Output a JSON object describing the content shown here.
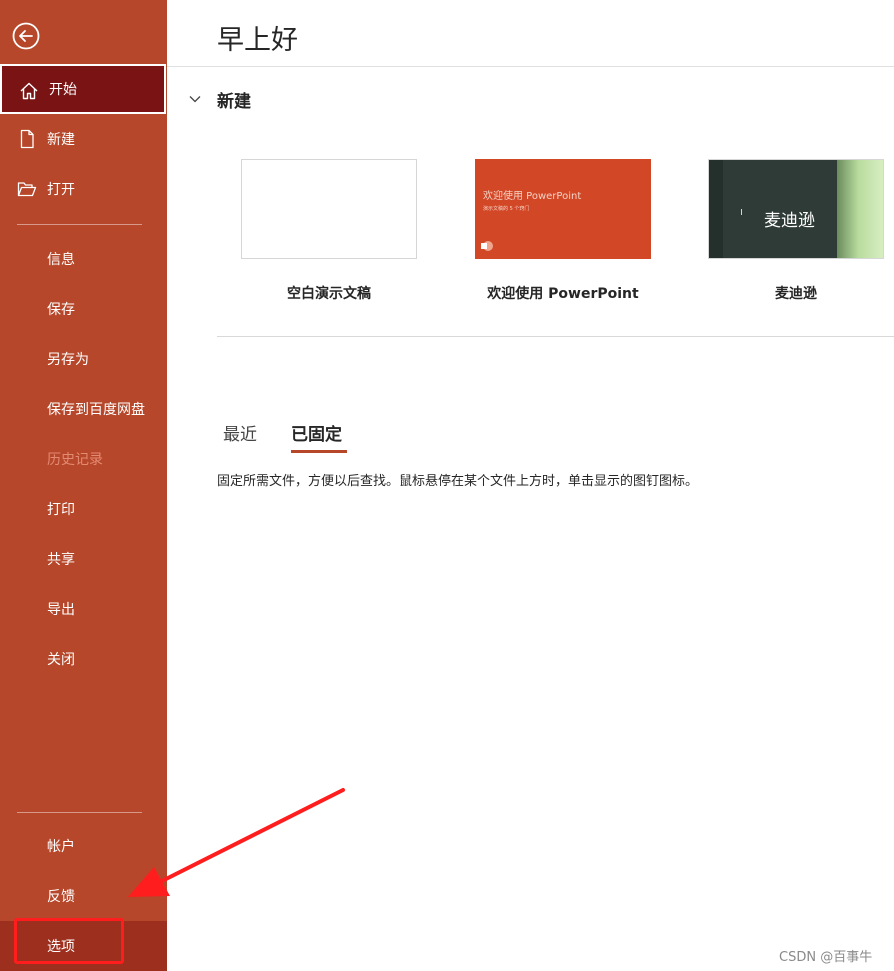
{
  "greeting": "早上好",
  "sidebar": {
    "items": [
      {
        "label": "开始",
        "icon": "home-icon"
      },
      {
        "label": "新建",
        "icon": "new-file-icon"
      },
      {
        "label": "打开",
        "icon": "open-folder-icon"
      },
      {
        "label": "信息"
      },
      {
        "label": "保存"
      },
      {
        "label": "另存为"
      },
      {
        "label": "保存到百度网盘"
      },
      {
        "label": "历史记录"
      },
      {
        "label": "打印"
      },
      {
        "label": "共享"
      },
      {
        "label": "导出"
      },
      {
        "label": "关闭"
      },
      {
        "label": "帐户"
      },
      {
        "label": "反馈"
      },
      {
        "label": "选项"
      }
    ],
    "active_item": "开始",
    "disabled_item": "历史记录",
    "highlighted_item": "选项"
  },
  "new_section": {
    "title": "新建",
    "templates": [
      {
        "caption": "空白演示文稿"
      },
      {
        "caption": "欢迎使用 PowerPoint",
        "thumb_title": "欢迎使用 PowerPoint",
        "thumb_subtitle": "演示文稿的 5 个窍门"
      },
      {
        "caption": "麦迪逊",
        "thumb_title": "麦迪逊"
      }
    ]
  },
  "tabs": {
    "recent": "最近",
    "pinned": "已固定",
    "selected": "已固定"
  },
  "pinned_hint": "固定所需文件，方便以后查找。鼠标悬停在某个文件上方时，单击显示的图钉图标。",
  "watermark": "CSDN @百事牛",
  "colors": {
    "sidebar": "#b7472a",
    "active_item": "#7a1414",
    "accent_underline": "#b7472a",
    "annotation": "#ff1d1d"
  }
}
